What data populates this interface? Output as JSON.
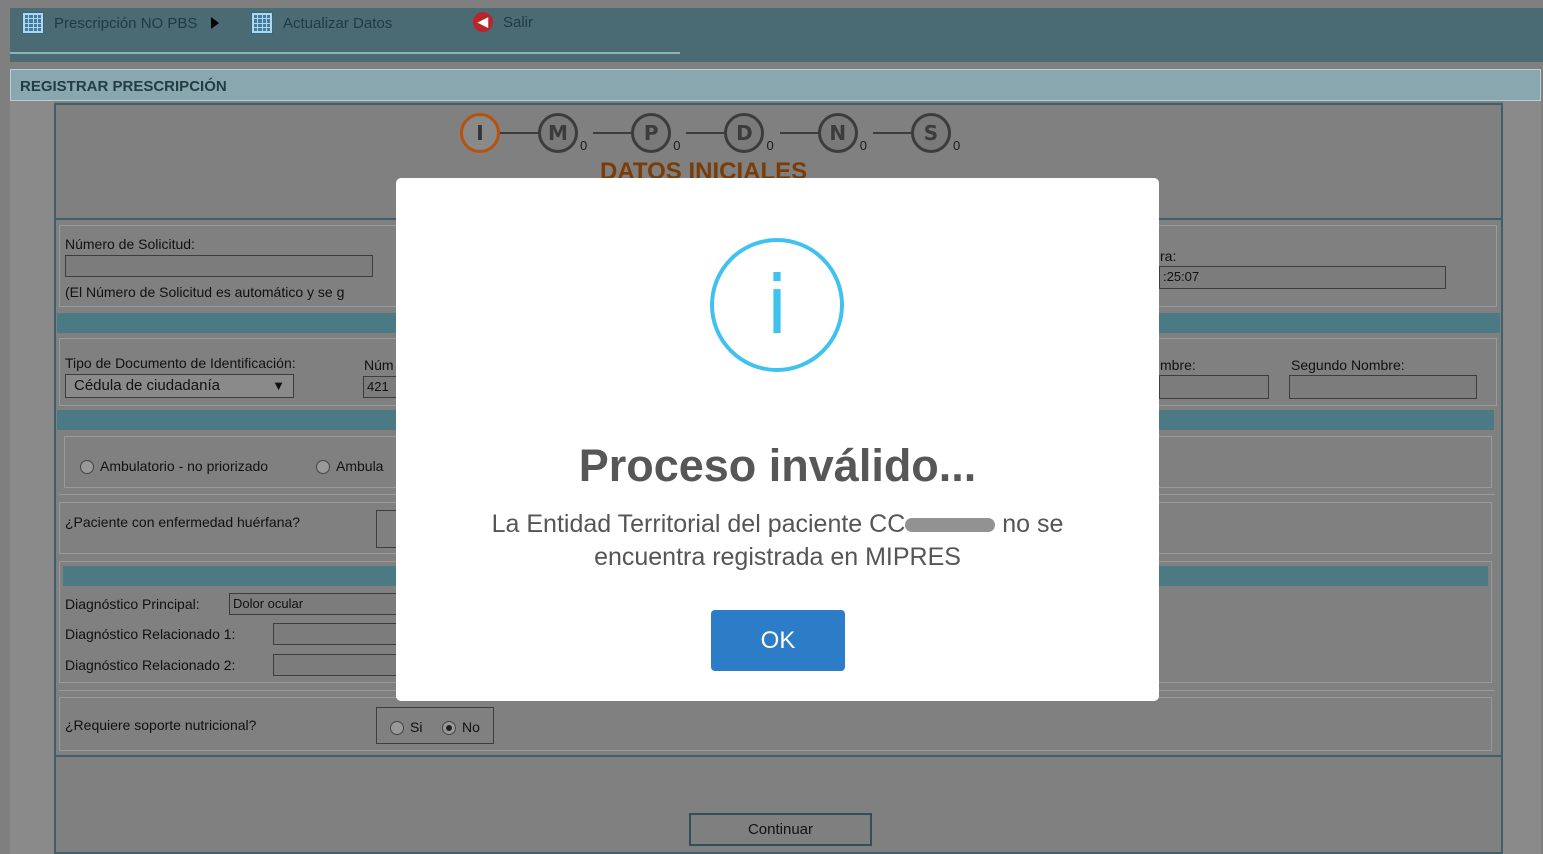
{
  "nav": {
    "prescripcion_label": "Prescripción NO PBS",
    "actualizar_label": "Actualizar Datos",
    "salir_label": "Salir"
  },
  "section": {
    "title": "REGISTRAR PRESCRIPCIÓN"
  },
  "steps": [
    {
      "letter": "I",
      "count": ""
    },
    {
      "letter": "M",
      "count": "0"
    },
    {
      "letter": "P",
      "count": "0"
    },
    {
      "letter": "D",
      "count": "0"
    },
    {
      "letter": "N",
      "count": "0"
    },
    {
      "letter": "S",
      "count": "0"
    }
  ],
  "step_title": "DATOS INICIALES",
  "form": {
    "numero_solicitud_label": "Número de Solicitud:",
    "numero_solicitud_note": "(El Número de Solicitud es automático y se g",
    "fecha_label": "ra:",
    "fecha_value": ":25:07",
    "tipo_doc_label": "Tipo de Documento de Identificación:",
    "tipo_doc_value": "Cédula de ciudadanía",
    "numero_label": "Núm",
    "numero_value": "421",
    "primer_nombre_label": "mbre:",
    "segundo_nombre_label": "Segundo Nombre:",
    "ambito_option1": "Ambulatorio - no priorizado",
    "ambito_option2": "Ambula",
    "huerfana_label": "¿Paciente con enfermedad huérfana?",
    "diag_principal_label": "Diagnóstico Principal:",
    "diag_principal_value": "Dolor ocular",
    "diag_rel1_label": "Diagnóstico Relacionado 1:",
    "diag_rel2_label": "Diagnóstico Relacionado 2:",
    "soporte_label": "¿Requiere soporte nutricional?",
    "soporte_si": "Si",
    "soporte_no": "No",
    "continuar_label": "Continuar"
  },
  "modal": {
    "title": "Proceso inválido...",
    "text_before": "La Entidad Territorial del paciente CC",
    "text_after": " no se encuentra registrada en MIPRES",
    "ok_label": "OK"
  }
}
